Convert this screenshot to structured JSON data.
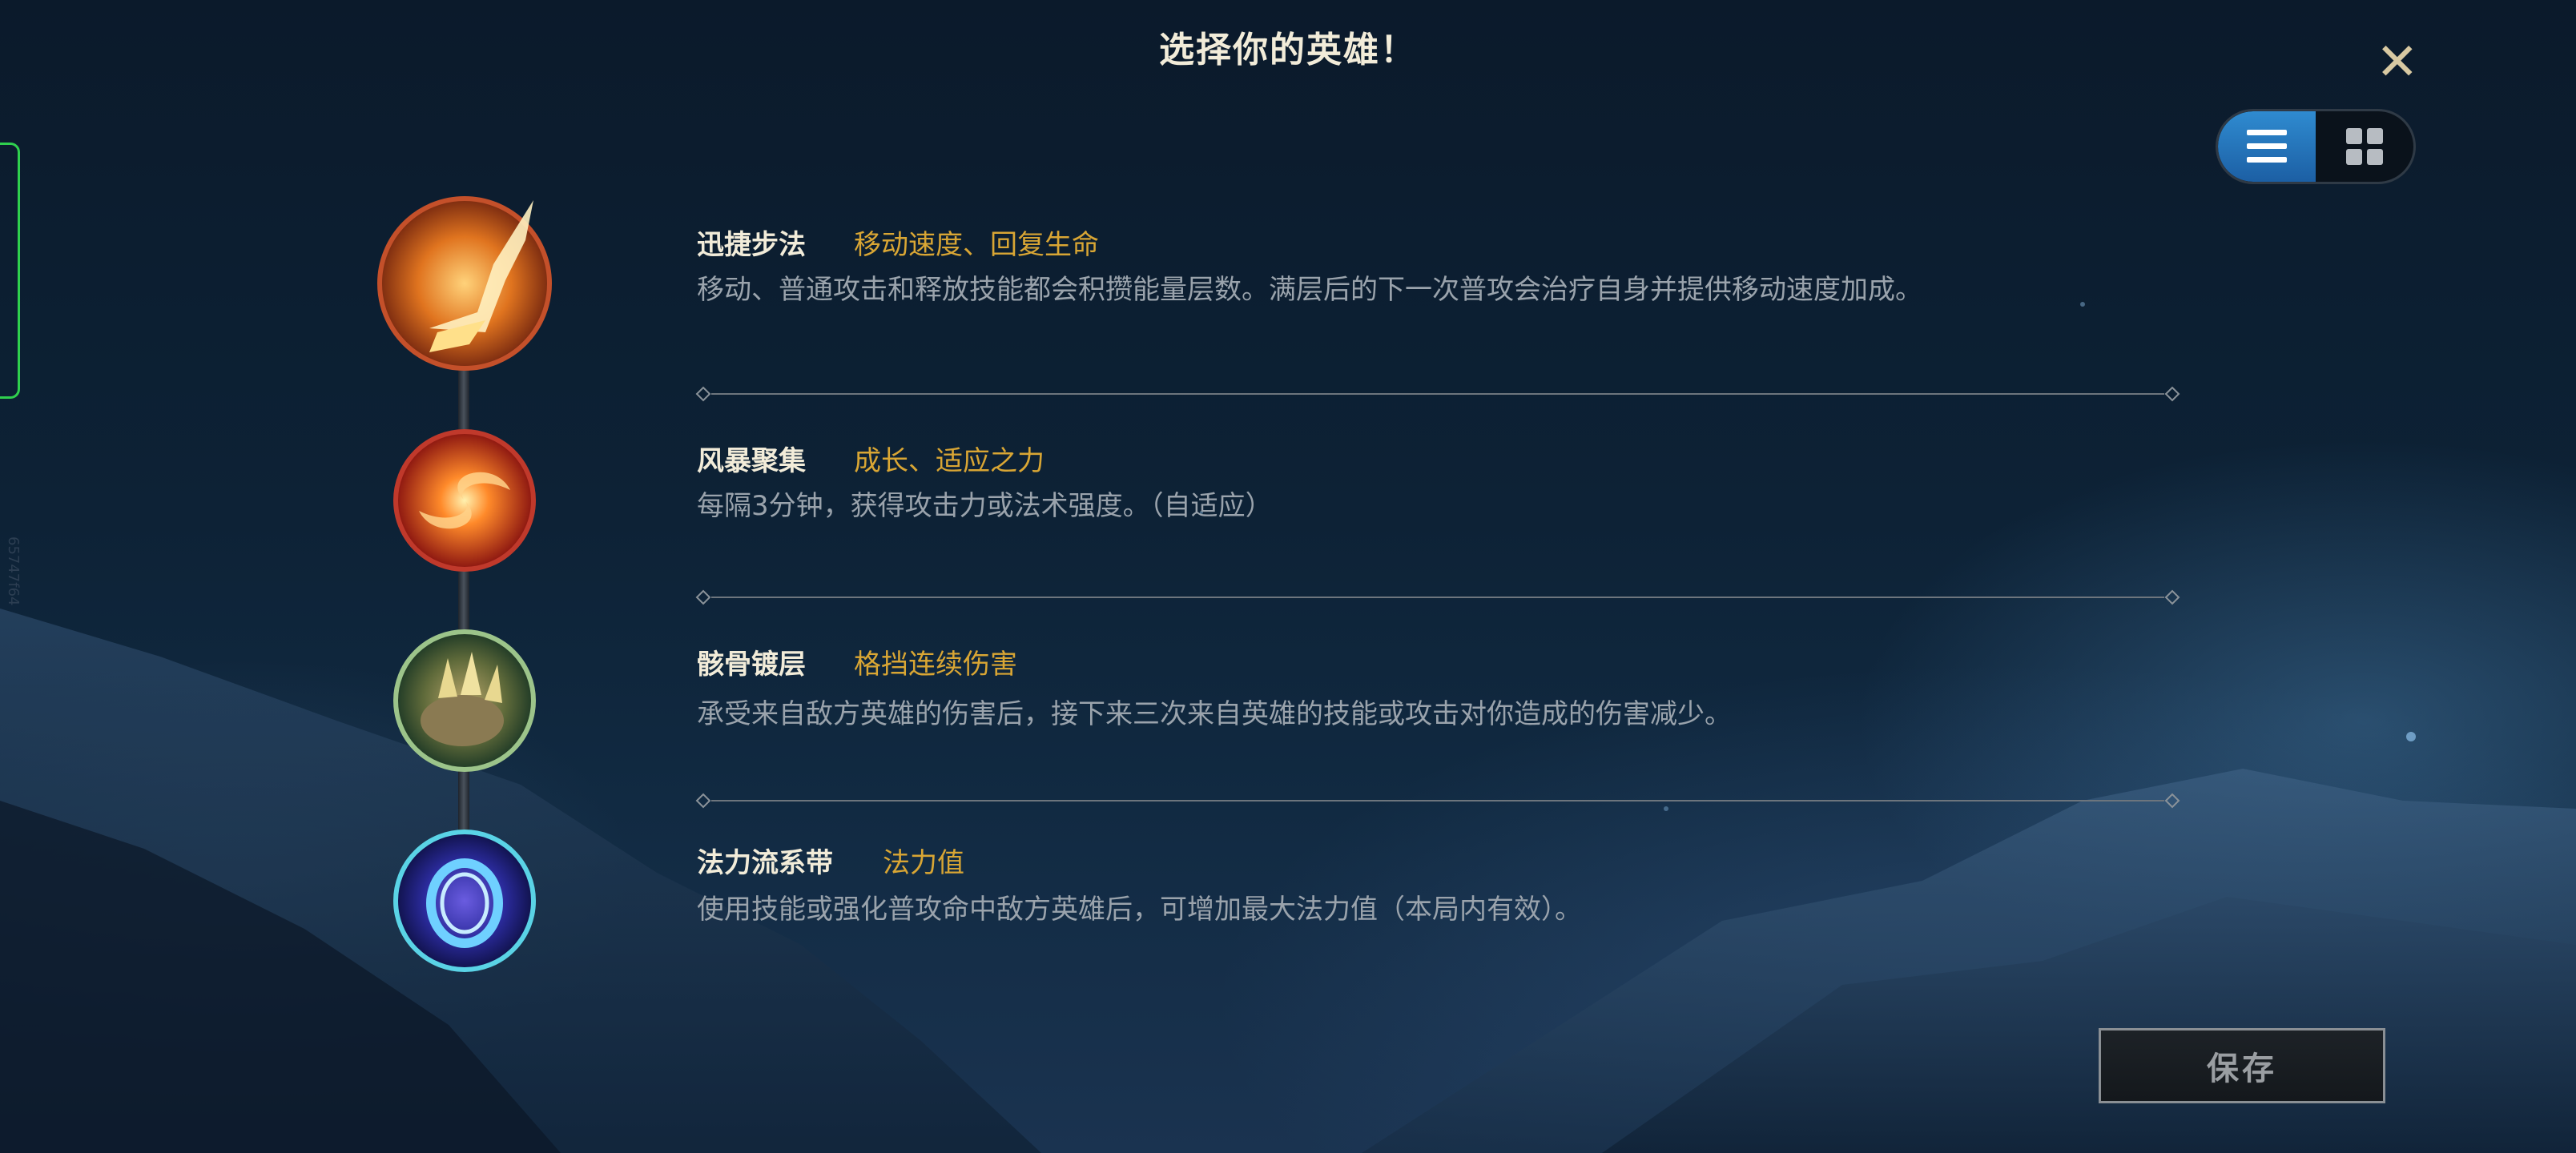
{
  "title": "选择你的英雄！",
  "close": {
    "symbol": "✕"
  },
  "view_toggle": {
    "active": "list",
    "options": [
      "list-view",
      "grid-view"
    ]
  },
  "side_id": "65747f64",
  "runes": [
    {
      "name": "迅捷步法",
      "tags": "移动速度、回复生命",
      "description": "移动、普通攻击和释放技能都会积攒能量层数。满层后的下一次普攻会治疗自身并提供移动速度加成。",
      "icon": "fleet-footwork-icon",
      "ring_color": "#c4502a"
    },
    {
      "name": "风暴聚集",
      "tags": "成长、适应之力",
      "description": "每隔3分钟，获得攻击力或法术强度。（自适应）",
      "icon": "gathering-storm-icon",
      "ring_color": "#c0392b"
    },
    {
      "name": "骸骨镀层",
      "tags": "格挡连续伤害",
      "description": "承受来自敌方英雄的伤害后，接下来三次来自英雄的技能或攻击对你造成的伤害减少。",
      "icon": "bone-plating-icon",
      "ring_color": "#9cc48a"
    },
    {
      "name": "法力流系带",
      "tags": "法力值",
      "description": "使用技能或强化普攻命中敌方英雄后，可增加最大法力值（本局内有效）。",
      "icon": "manaflow-band-icon",
      "ring_color": "#5ad3e6"
    }
  ],
  "save_label": "保存",
  "colors": {
    "accent_gold": "#d9a634",
    "toggle_active": "#2f8bd0"
  }
}
